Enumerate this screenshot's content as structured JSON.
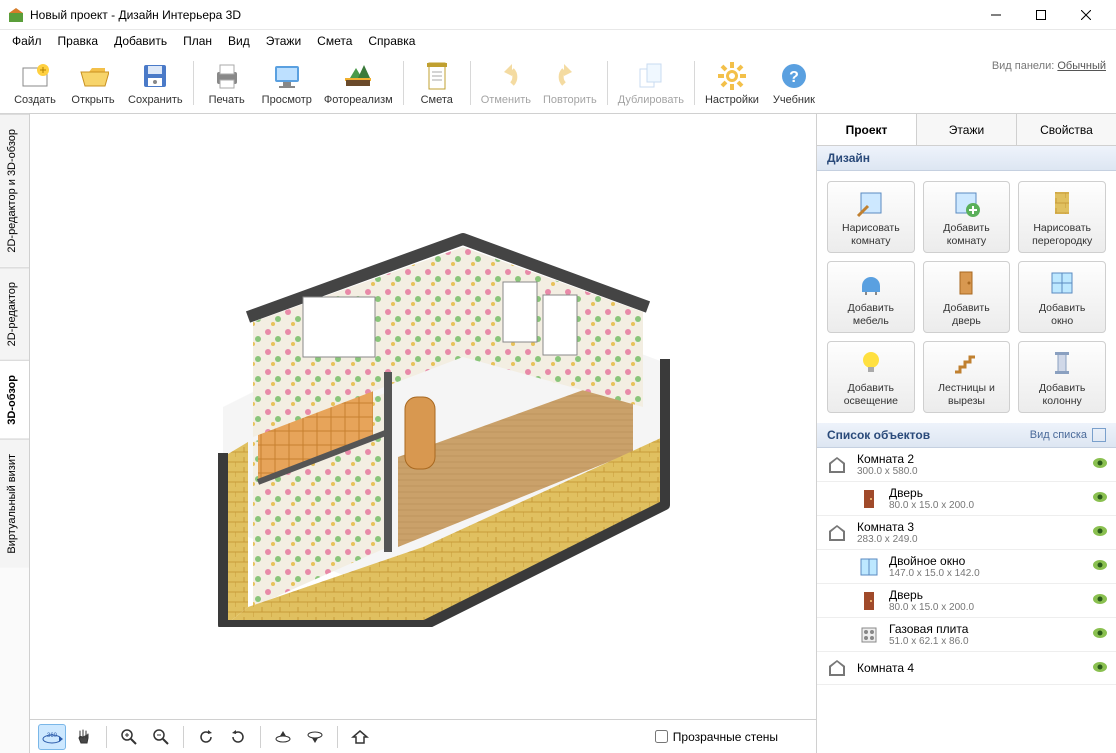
{
  "window": {
    "title": "Новый проект - Дизайн Интерьера 3D"
  },
  "menu": [
    "Файл",
    "Правка",
    "Добавить",
    "План",
    "Вид",
    "Этажи",
    "Смета",
    "Справка"
  ],
  "toolbar": [
    {
      "id": "create",
      "label": "Создать"
    },
    {
      "id": "open",
      "label": "Открыть"
    },
    {
      "id": "save",
      "label": "Сохранить"
    },
    {
      "sep": true
    },
    {
      "id": "print",
      "label": "Печать"
    },
    {
      "id": "preview",
      "label": "Просмотр"
    },
    {
      "id": "photoreal",
      "label": "Фотореализм"
    },
    {
      "sep": true
    },
    {
      "id": "estimate",
      "label": "Смета"
    },
    {
      "sep": true
    },
    {
      "id": "undo",
      "label": "Отменить",
      "disabled": true
    },
    {
      "id": "redo",
      "label": "Повторить",
      "disabled": true
    },
    {
      "sep": true
    },
    {
      "id": "duplicate",
      "label": "Дублировать",
      "disabled": true
    },
    {
      "sep": true
    },
    {
      "id": "settings",
      "label": "Настройки"
    },
    {
      "id": "tutorial",
      "label": "Учебник"
    }
  ],
  "panel_mode": {
    "label": "Вид панели:",
    "value": "Обычный"
  },
  "left_tabs": [
    {
      "id": "combo",
      "label": "2D-редактор и 3D-обзор"
    },
    {
      "id": "edit2d",
      "label": "2D-редактор"
    },
    {
      "id": "view3d",
      "label": "3D-обзор",
      "active": true
    },
    {
      "id": "virtual",
      "label": "Виртуальный визит"
    }
  ],
  "view_toolbar": {
    "rotate360": "360",
    "transparent_walls_label": "Прозрачные стены",
    "transparent_walls_checked": false
  },
  "right_panel": {
    "tabs": [
      {
        "id": "project",
        "label": "Проект",
        "active": true
      },
      {
        "id": "floors",
        "label": "Этажи"
      },
      {
        "id": "properties",
        "label": "Свойства"
      }
    ],
    "design_header": "Дизайн",
    "design_buttons": [
      {
        "id": "draw-room",
        "label": "Нарисовать\nкомнату"
      },
      {
        "id": "add-room",
        "label": "Добавить\nкомнату"
      },
      {
        "id": "draw-partition",
        "label": "Нарисовать\nперегородку"
      },
      {
        "id": "add-furniture",
        "label": "Добавить\nмебель"
      },
      {
        "id": "add-door",
        "label": "Добавить\nдверь"
      },
      {
        "id": "add-window",
        "label": "Добавить\nокно"
      },
      {
        "id": "add-light",
        "label": "Добавить\nосвещение"
      },
      {
        "id": "stairs",
        "label": "Лестницы и\nвырезы"
      },
      {
        "id": "add-column",
        "label": "Добавить\nколонну"
      }
    ],
    "objects_header": "Список объектов",
    "objects_view_label": "Вид списка",
    "objects": [
      {
        "type": "room",
        "name": "Комната 2",
        "dim": "300.0 x 580.0"
      },
      {
        "type": "door",
        "name": "Дверь",
        "dim": "80.0 x 15.0 x 200.0",
        "indent": true
      },
      {
        "type": "room",
        "name": "Комната 3",
        "dim": "283.0 x 249.0"
      },
      {
        "type": "window",
        "name": "Двойное окно",
        "dim": "147.0 x 15.0 x 142.0",
        "indent": true
      },
      {
        "type": "door",
        "name": "Дверь",
        "dim": "80.0 x 15.0 x 200.0",
        "indent": true
      },
      {
        "type": "stove",
        "name": "Газовая плита",
        "dim": "51.0 x 62.1 x 86.0",
        "indent": true
      },
      {
        "type": "room",
        "name": "Комната 4",
        "dim": "",
        "partial": true
      }
    ]
  }
}
